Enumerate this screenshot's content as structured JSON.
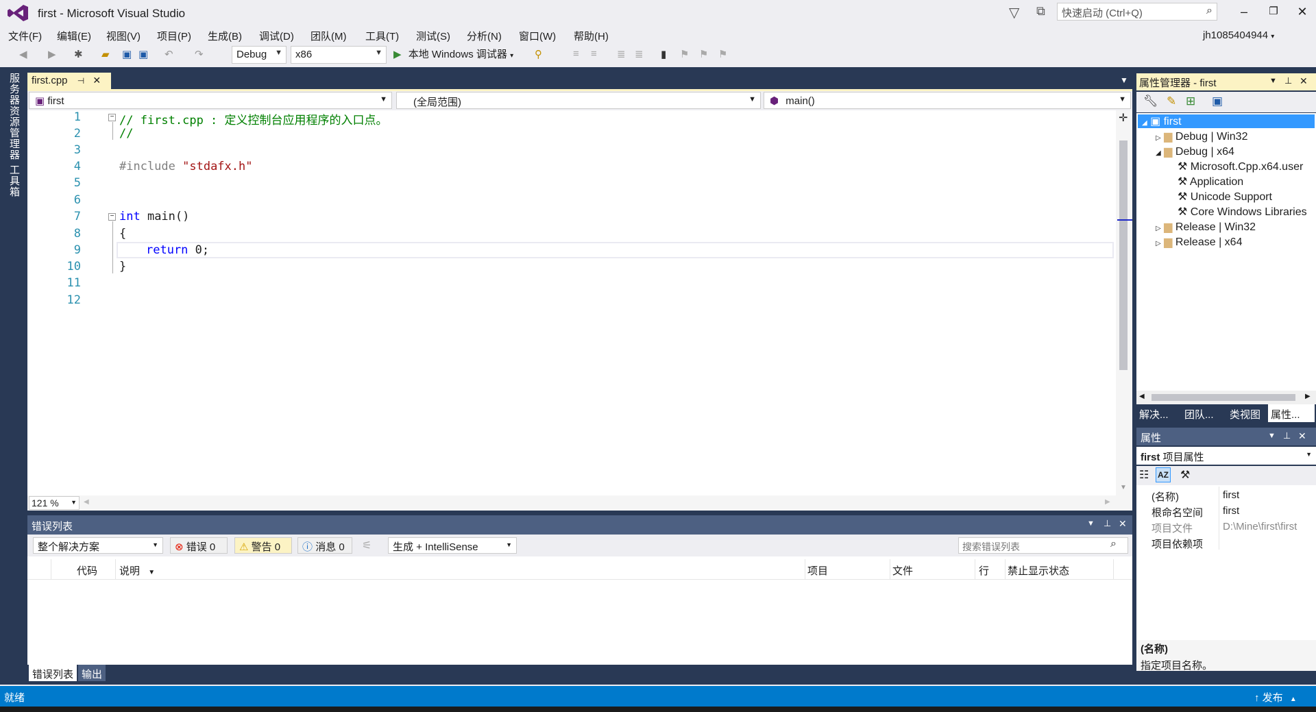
{
  "window": {
    "title": "first - Microsoft Visual Studio",
    "quick_launch_placeholder": "快速启动 (Ctrl+Q)",
    "user": "jh1085404944",
    "colors": {
      "accent": "#007acc",
      "panel_dark": "#293955",
      "active_tab": "#fcf3c4",
      "keyword": "#0000ff",
      "comment": "#008000",
      "string": "#a31515",
      "line_number": "#2b91af"
    }
  },
  "menu": [
    "文件(F)",
    "编辑(E)",
    "视图(V)",
    "项目(P)",
    "生成(B)",
    "调试(D)",
    "团队(M)",
    "工具(T)",
    "测试(S)",
    "分析(N)",
    "窗口(W)",
    "帮助(H)"
  ],
  "toolbar": {
    "config": "Debug",
    "platform": "x86",
    "debugger": "本地 Windows 调试器"
  },
  "left_tabs": [
    "服务器资源管理器",
    "工具箱"
  ],
  "editor": {
    "tab_name": "first.cpp",
    "nav_project": "first",
    "nav_scope": "(全局范围)",
    "nav_member": "main()",
    "zoom": "121 %",
    "lines": [
      "1",
      "2",
      "3",
      "4",
      "5",
      "6",
      "7",
      "8",
      "9",
      "10",
      "11",
      "12"
    ],
    "code": {
      "l1": "// first.cpp : 定义控制台应用程序的入口点。",
      "l2": "//",
      "l4_pp": "#include ",
      "l4_str": "\"stdafx.h\"",
      "l7_kw": "int",
      "l7_rest": " main()",
      "l8": "{",
      "l9_kw": "return",
      "l9_rest": " 0;",
      "l10": "}"
    }
  },
  "error_list": {
    "title": "错误列表",
    "scope": "整个解决方案",
    "errors": "错误 0",
    "warnings": "警告 0",
    "messages": "消息 0",
    "build_filter": "生成 + IntelliSense",
    "search_placeholder": "搜索错误列表",
    "columns": [
      "代码",
      "说明",
      "项目",
      "文件",
      "行",
      "禁止显示状态"
    ],
    "bottom_tabs": [
      "错误列表",
      "输出"
    ]
  },
  "property_manager": {
    "title": "属性管理器 - first",
    "tree": [
      {
        "label": "first",
        "level": 0
      },
      {
        "label": "Debug | Win32",
        "level": 1
      },
      {
        "label": "Debug | x64",
        "level": 1
      },
      {
        "label": "Microsoft.Cpp.x64.user",
        "level": 2
      },
      {
        "label": "Application",
        "level": 2
      },
      {
        "label": "Unicode Support",
        "level": 2
      },
      {
        "label": "Core Windows Libraries",
        "level": 2
      },
      {
        "label": "Release | Win32",
        "level": 1
      },
      {
        "label": "Release | x64",
        "level": 1
      }
    ],
    "tabs": [
      "解决...",
      "团队...",
      "类视图",
      "属性..."
    ]
  },
  "properties": {
    "title": "属性",
    "object_bold": "first",
    "object_rest": "项目属性",
    "rows": [
      {
        "k": "(名称)",
        "v": "first"
      },
      {
        "k": "根命名空间",
        "v": "first"
      },
      {
        "k": "项目文件",
        "v": "D:\\Mine\\first\\first"
      },
      {
        "k": "项目依赖项",
        "v": ""
      }
    ],
    "desc_title": "(名称)",
    "desc_text": "指定项目名称。"
  },
  "status": {
    "text": "就绪",
    "publish": "发布"
  }
}
